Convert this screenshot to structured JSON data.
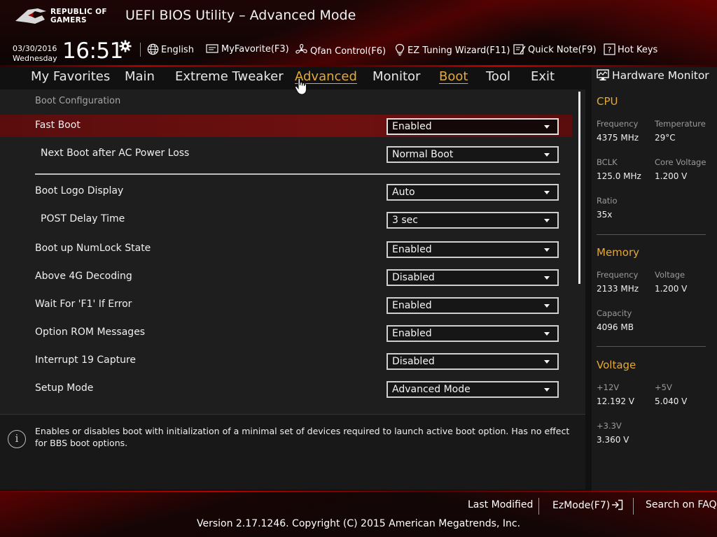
{
  "header": {
    "logo_line1": "REPUBLIC OF",
    "logo_line2": "GAMERS",
    "title": "UEFI BIOS Utility – Advanced Mode",
    "date": "03/30/2016",
    "day": "Wednesday",
    "time": "16:51",
    "tools": {
      "language": "English",
      "myfavorite": "MyFavorite(F3)",
      "qfan": "Qfan Control(F6)",
      "ez_tuning": "EZ Tuning Wizard(F11)",
      "quick_note": "Quick Note(F9)",
      "hot_keys": "Hot Keys"
    }
  },
  "nav": {
    "tabs": [
      "My Favorites",
      "Main",
      "Extreme Tweaker",
      "Advanced",
      "Monitor",
      "Boot",
      "Tool",
      "Exit"
    ],
    "active": "Boot"
  },
  "main": {
    "section_title": "Boot Configuration",
    "settings": [
      {
        "label": "Fast Boot",
        "value": "Enabled"
      },
      {
        "label": "Next Boot after AC Power Loss",
        "value": "Normal Boot"
      },
      {
        "label": "Boot Logo Display",
        "value": "Auto"
      },
      {
        "label": "POST Delay Time",
        "value": "3 sec"
      },
      {
        "label": "Boot up NumLock State",
        "value": "Enabled"
      },
      {
        "label": "Above 4G Decoding",
        "value": "Disabled"
      },
      {
        "label": "Wait For 'F1' If Error",
        "value": "Enabled"
      },
      {
        "label": "Option ROM Messages",
        "value": "Enabled"
      },
      {
        "label": "Interrupt 19 Capture",
        "value": "Disabled"
      },
      {
        "label": "Setup Mode",
        "value": "Advanced Mode"
      }
    ],
    "info": "Enables or disables boot with initialization of a minimal set of devices required to launch active boot option. Has no effect for BBS boot options."
  },
  "hardware_monitor": {
    "title": "Hardware Monitor",
    "cpu": {
      "heading": "CPU",
      "frequency_label": "Frequency",
      "frequency": "4375 MHz",
      "temperature_label": "Temperature",
      "temperature": "29°C",
      "bclk_label": "BCLK",
      "bclk": "125.0 MHz",
      "core_voltage_label": "Core Voltage",
      "core_voltage": "1.200 V",
      "ratio_label": "Ratio",
      "ratio": "35x"
    },
    "memory": {
      "heading": "Memory",
      "frequency_label": "Frequency",
      "frequency": "2133 MHz",
      "voltage_label": "Voltage",
      "voltage": "1.200 V",
      "capacity_label": "Capacity",
      "capacity": "4096 MB"
    },
    "voltage": {
      "heading": "Voltage",
      "v12_label": "+12V",
      "v12": "12.192 V",
      "v5_label": "+5V",
      "v5": "5.040 V",
      "v33_label": "+3.3V",
      "v33": "3.360 V"
    }
  },
  "footer": {
    "last_modified": "Last Modified",
    "ez_mode": "EzMode(F7)",
    "search_faq": "Search on FAQ",
    "copyright": "Version 2.17.1246. Copyright (C) 2015 American Megatrends, Inc."
  },
  "colors": {
    "accent": "#e3a93b",
    "highlight_row": "#6e1010",
    "brand_red": "#b00000"
  },
  "icons": [
    "rog-logo-icon",
    "gear-icon",
    "globe-icon",
    "favorite-icon",
    "fan-icon",
    "bulb-icon",
    "note-icon",
    "help-icon",
    "monitor-icon",
    "info-icon",
    "exit-arrow-icon",
    "hand-cursor-icon"
  ]
}
